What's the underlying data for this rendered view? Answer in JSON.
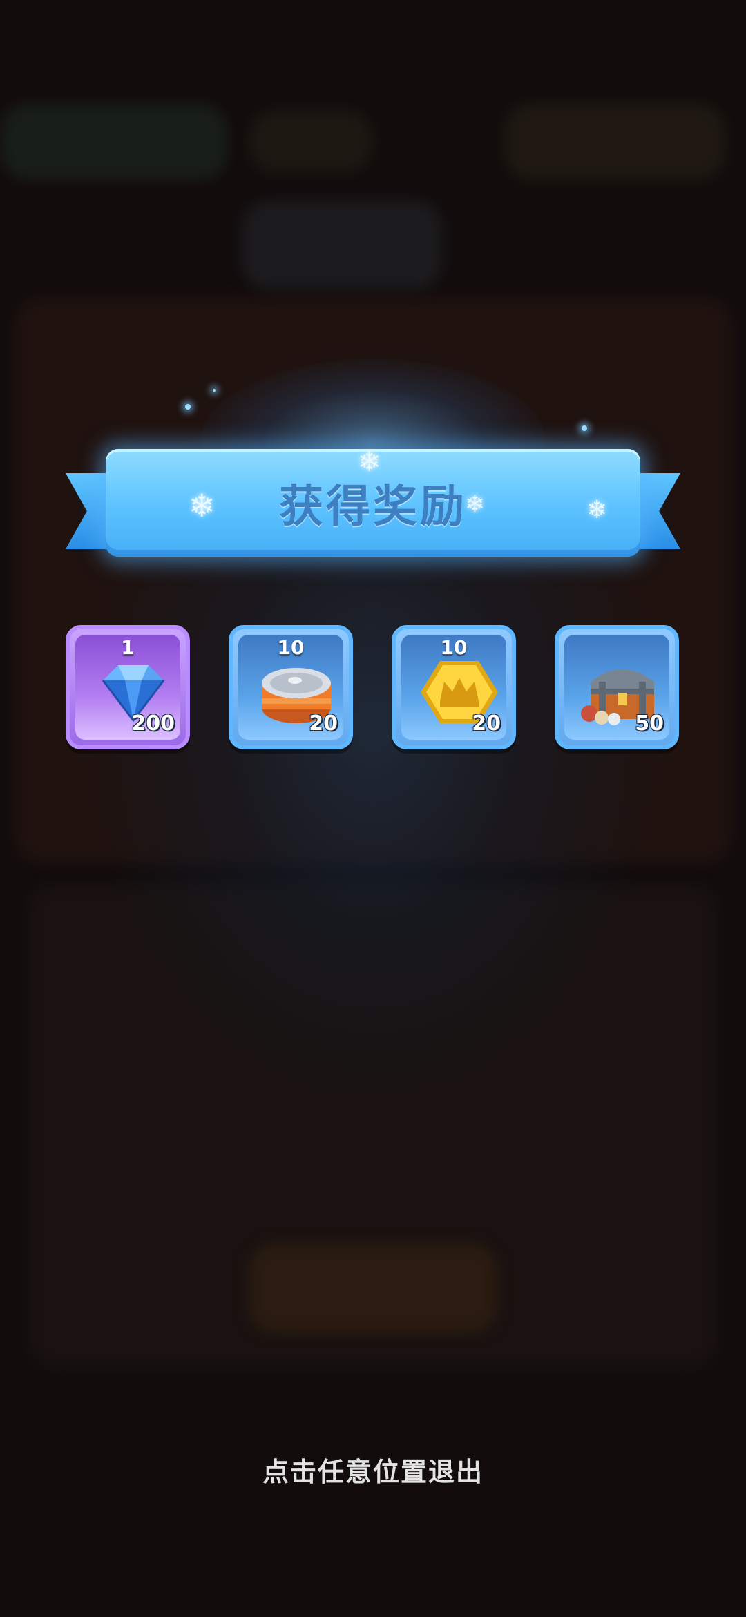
{
  "banner": {
    "title": "获得奖励"
  },
  "rewards": [
    {
      "icon": "diamond-icon",
      "top": "1",
      "bottom": "200",
      "frame": "purple"
    },
    {
      "icon": "canned-food-icon",
      "top": "10",
      "bottom": "20",
      "frame": "blue"
    },
    {
      "icon": "crown-token-icon",
      "top": "10",
      "bottom": "20",
      "frame": "blue"
    },
    {
      "icon": "treasure-chest-icon",
      "top": "",
      "bottom": "50",
      "frame": "blue"
    }
  ],
  "footer": {
    "exit_hint": "点击任意位置退出"
  },
  "colors": {
    "banner": "#5cc2ff",
    "banner_text": "#3d7fc0",
    "purple_frame": "#b98cff",
    "blue_frame": "#5fb8ff",
    "background": "#120c0c"
  }
}
